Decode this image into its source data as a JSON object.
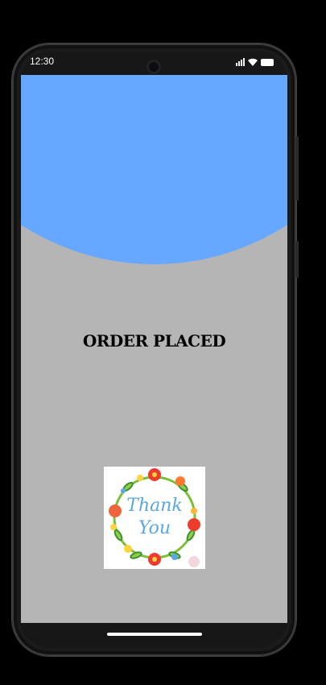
{
  "status_bar": {
    "time": "12:30"
  },
  "screen": {
    "heading": "ORDER PLACED"
  },
  "thank_you_card": {
    "line1": "Thank",
    "line2": "You"
  },
  "colors": {
    "header": "#66a8ff",
    "background": "#b5b5b5"
  },
  "icons": [
    "signal-icon",
    "wifi-icon",
    "battery-icon"
  ]
}
